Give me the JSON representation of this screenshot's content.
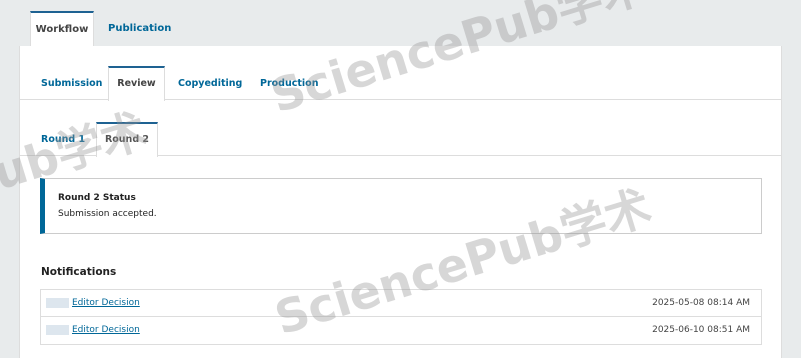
{
  "top_tabs": {
    "workflow": "Workflow",
    "publication": "Publication"
  },
  "stage_tabs": {
    "submission": "Submission",
    "review": "Review",
    "copyediting": "Copyediting",
    "production": "Production"
  },
  "round_tabs": {
    "round1": "Round 1",
    "round2": "Round 2"
  },
  "status": {
    "title": "Round 2 Status",
    "text": "Submission accepted."
  },
  "notifications": {
    "heading": "Notifications",
    "items": [
      {
        "label": "Editor Decision",
        "date": "2025-05-08 08:14 AM"
      },
      {
        "label": "Editor Decision",
        "date": "2025-06-10 08:51 AM"
      }
    ]
  },
  "watermark": {
    "text": "SciencePub学术"
  },
  "colors": {
    "accent": "#006798",
    "tab_border": "#1e6292",
    "background": "#e8ebec",
    "panel": "#ffffff"
  }
}
